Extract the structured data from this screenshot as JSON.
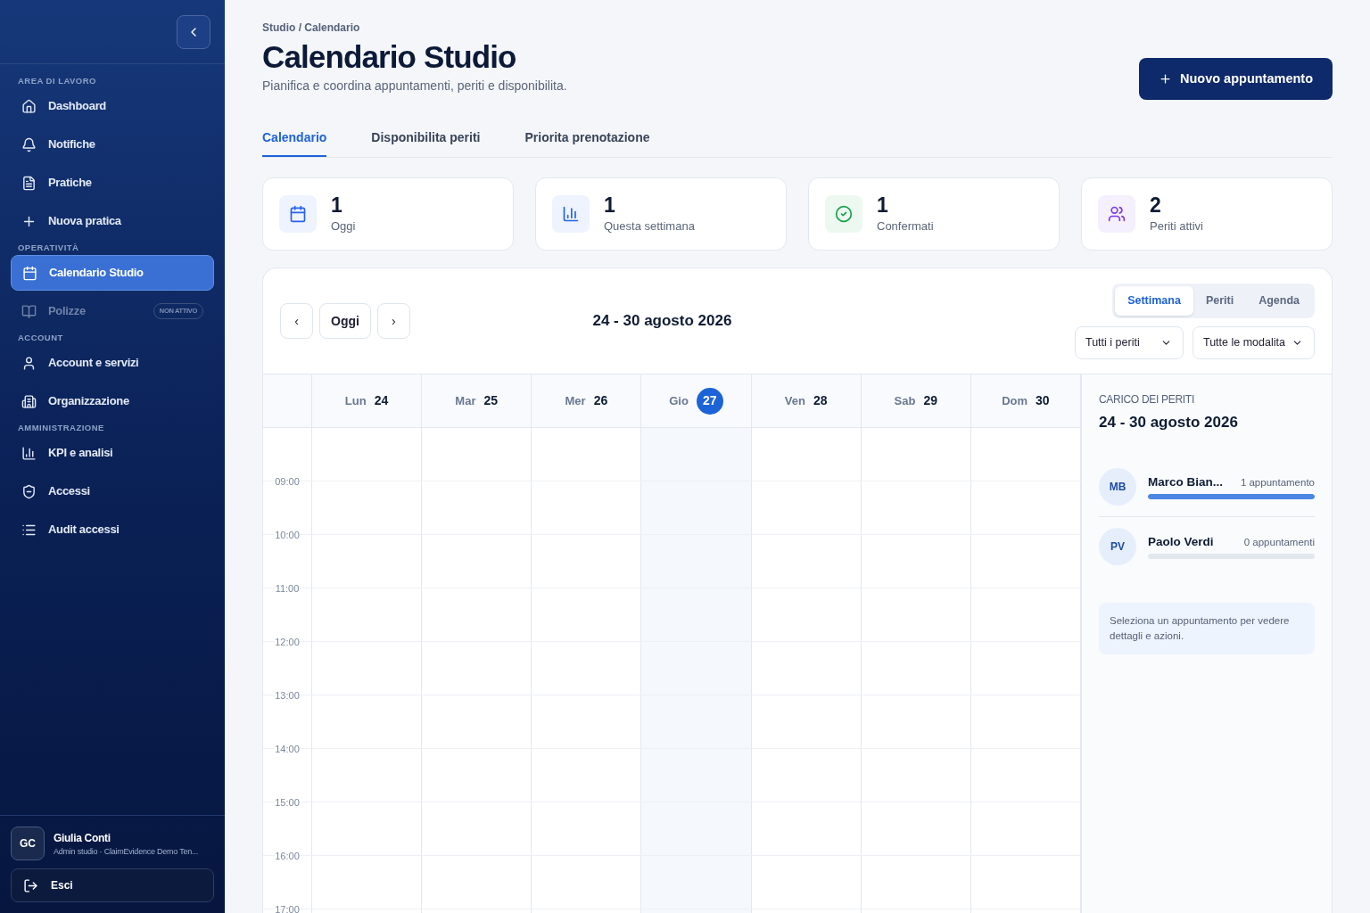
{
  "sidebar": {
    "sections": [
      {
        "title": "AREA DI LAVORO",
        "items": [
          {
            "label": "Dashboard",
            "selected": false,
            "disabled": false
          },
          {
            "label": "Notifiche",
            "selected": false,
            "disabled": false
          },
          {
            "label": "Pratiche",
            "selected": false,
            "disabled": false
          },
          {
            "label": "Nuova pratica",
            "selected": false,
            "disabled": false
          }
        ]
      },
      {
        "title": "OPERATIVITÀ",
        "items": [
          {
            "label": "Calendario Studio",
            "selected": true,
            "disabled": false
          },
          {
            "label": "Polizze",
            "selected": false,
            "disabled": true,
            "badge": "NON ATTIVO"
          }
        ]
      },
      {
        "title": "ACCOUNT",
        "items": [
          {
            "label": "Account e servizi",
            "selected": false,
            "disabled": false
          },
          {
            "label": "Organizzazione",
            "selected": false,
            "disabled": false
          }
        ]
      },
      {
        "title": "AMMINISTRAZIONE",
        "items": [
          {
            "label": "KPI e analisi",
            "selected": false,
            "disabled": false
          },
          {
            "label": "Accessi",
            "selected": false,
            "disabled": false
          },
          {
            "label": "Audit accessi",
            "selected": false,
            "disabled": false
          }
        ]
      }
    ],
    "user": {
      "initials": "GC",
      "name": "Giulia Conti",
      "role": "Admin studio · ClaimEvidence Demo Ten..."
    },
    "logout": "Esci"
  },
  "breadcrumb": "Studio / Calendario",
  "title": "Calendario Studio",
  "subtitle": "Pianifica e coordina appuntamenti, periti e disponibilita.",
  "primary_button": "Nuovo appuntamento",
  "tabs": [
    {
      "label": "Calendario",
      "selected": true
    },
    {
      "label": "Disponibilita periti",
      "selected": false
    },
    {
      "label": "Priorita prenotazione",
      "selected": false
    }
  ],
  "stats": [
    {
      "value": "1",
      "label": "Oggi",
      "color": "#2563eb"
    },
    {
      "value": "1",
      "label": "Questa settimana",
      "color": "#2563eb"
    },
    {
      "value": "1",
      "label": "Confermati",
      "color": "#16a34a"
    },
    {
      "value": "2",
      "label": "Periti attivi",
      "color": "#7c3aed"
    }
  ],
  "calendar": {
    "prev": "‹",
    "today": "Oggi",
    "next": "›",
    "range": "24 - 30 agosto 2026",
    "views": [
      {
        "label": "Settimana",
        "selected": true
      },
      {
        "label": "Periti",
        "selected": false
      },
      {
        "label": "Agenda",
        "selected": false
      }
    ],
    "filters": [
      "Tutti i periti",
      "Tutte le modalita"
    ],
    "days": [
      {
        "name": "Lun",
        "date": "24",
        "today": false
      },
      {
        "name": "Mar",
        "date": "25",
        "today": false
      },
      {
        "name": "Mer",
        "date": "26",
        "today": false
      },
      {
        "name": "Gio",
        "date": "27",
        "today": true
      },
      {
        "name": "Ven",
        "date": "28",
        "today": false
      },
      {
        "name": "Sab",
        "date": "29",
        "today": false
      },
      {
        "name": "Dom",
        "date": "30",
        "today": false
      }
    ],
    "hours": [
      "09:00",
      "10:00",
      "11:00",
      "12:00",
      "13:00",
      "14:00",
      "15:00",
      "16:00",
      "17:00"
    ]
  },
  "workload": {
    "title": "CARICO DEI PERITI",
    "range": "24 - 30 agosto 2026",
    "experts": [
      {
        "initials": "MB",
        "name": "Marco Bian...",
        "count": "1 appuntamento",
        "level": 1
      },
      {
        "initials": "PV",
        "name": "Paolo Verdi",
        "count": "0 appuntamenti",
        "level": 0
      }
    ],
    "hint": "Seleziona un appuntamento per vedere dettagli e azioni."
  }
}
